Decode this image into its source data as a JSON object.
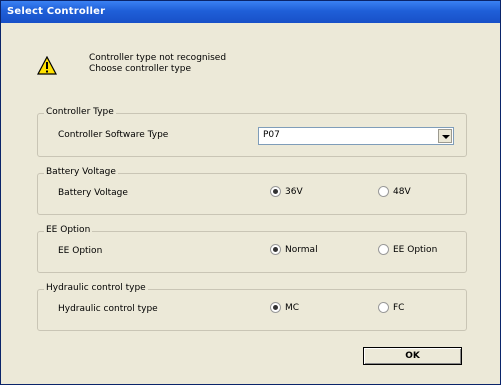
{
  "window": {
    "title": "Select Controller"
  },
  "message": {
    "line1": "Controller type not recognised",
    "line2": "Choose controller type"
  },
  "controller_type": {
    "legend": "Controller Type",
    "label": "Controller Software Type",
    "selected": "P07"
  },
  "battery_voltage": {
    "legend": "Battery Voltage",
    "label": "Battery Voltage",
    "options": [
      "36V",
      "48V"
    ],
    "selected": "36V"
  },
  "ee_option": {
    "legend": "EE Option",
    "label": "EE Option",
    "options": [
      "Normal",
      "EE Option"
    ],
    "selected": "Normal"
  },
  "hydraulic": {
    "legend": "Hydraulic control type",
    "label": "Hydraulic control type",
    "options": [
      "MC",
      "FC"
    ],
    "selected": "MC"
  },
  "buttons": {
    "ok": "OK"
  },
  "icons": {
    "warning": "warning-icon",
    "dropdown": "chevron-down-icon"
  },
  "colors": {
    "titlebar": "#1f5fd8",
    "dialog_bg": "#ece9d8",
    "warning_fill": "#ffe100"
  }
}
